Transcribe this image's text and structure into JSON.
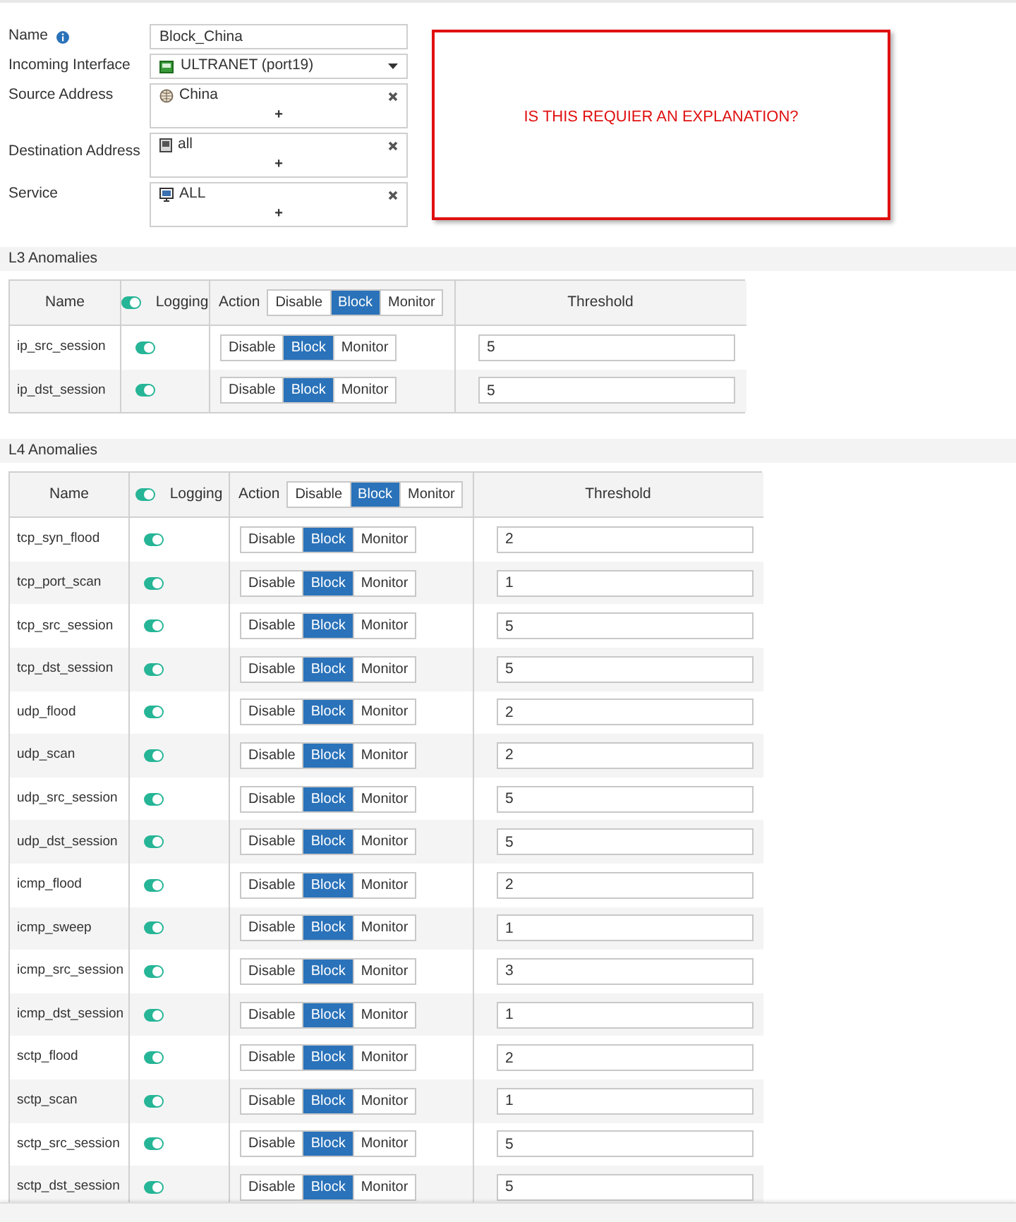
{
  "form": {
    "name": {
      "label": "Name",
      "value": "Block_China"
    },
    "incoming_interface": {
      "label": "Incoming Interface",
      "value": "ULTRANET (port19)"
    },
    "address_fields": [
      {
        "label": "Source Address",
        "kind": "globe",
        "item": "China",
        "add": "+"
      },
      {
        "label": "Destination Address",
        "kind": "monitor",
        "item": "all",
        "add": "+"
      },
      {
        "label": "Service",
        "kind": "service",
        "item": "ALL",
        "add": "+"
      }
    ]
  },
  "annotation": {
    "text": "IS THIS REQUIER AN EXPLANATION?"
  },
  "sections": [
    {
      "title": "L3 Anomalies",
      "columns": {
        "name": "Name",
        "logging": "Logging",
        "logging_on": true,
        "action": "Action",
        "actions": [
          {
            "label": "Disable",
            "selected": false
          },
          {
            "label": "Block",
            "selected": true
          },
          {
            "label": "Monitor",
            "selected": false
          }
        ],
        "threshold": "Threshold"
      },
      "rows": [
        {
          "name": "ip_src_session",
          "logging": true,
          "actions": [
            {
              "label": "Disable",
              "selected": false
            },
            {
              "label": "Block",
              "selected": true
            },
            {
              "label": "Monitor",
              "selected": false
            }
          ],
          "threshold": "5"
        },
        {
          "name": "ip_dst_session",
          "logging": true,
          "actions": [
            {
              "label": "Disable",
              "selected": false
            },
            {
              "label": "Block",
              "selected": true
            },
            {
              "label": "Monitor",
              "selected": false
            }
          ],
          "threshold": "5"
        }
      ]
    },
    {
      "title": "L4 Anomalies",
      "columns": {
        "name": "Name",
        "logging": "Logging",
        "logging_on": true,
        "action": "Action",
        "actions": [
          {
            "label": "Disable",
            "selected": false
          },
          {
            "label": "Block",
            "selected": true
          },
          {
            "label": "Monitor",
            "selected": false
          }
        ],
        "threshold": "Threshold"
      },
      "rows": [
        {
          "name": "tcp_syn_flood",
          "logging": true,
          "actions": [
            {
              "label": "Disable",
              "selected": false
            },
            {
              "label": "Block",
              "selected": true
            },
            {
              "label": "Monitor",
              "selected": false
            }
          ],
          "threshold": "2"
        },
        {
          "name": "tcp_port_scan",
          "logging": true,
          "actions": [
            {
              "label": "Disable",
              "selected": false
            },
            {
              "label": "Block",
              "selected": true
            },
            {
              "label": "Monitor",
              "selected": false
            }
          ],
          "threshold": "1"
        },
        {
          "name": "tcp_src_session",
          "logging": true,
          "actions": [
            {
              "label": "Disable",
              "selected": false
            },
            {
              "label": "Block",
              "selected": true
            },
            {
              "label": "Monitor",
              "selected": false
            }
          ],
          "threshold": "5"
        },
        {
          "name": "tcp_dst_session",
          "logging": true,
          "actions": [
            {
              "label": "Disable",
              "selected": false
            },
            {
              "label": "Block",
              "selected": true
            },
            {
              "label": "Monitor",
              "selected": false
            }
          ],
          "threshold": "5"
        },
        {
          "name": "udp_flood",
          "logging": true,
          "actions": [
            {
              "label": "Disable",
              "selected": false
            },
            {
              "label": "Block",
              "selected": true
            },
            {
              "label": "Monitor",
              "selected": false
            }
          ],
          "threshold": "2"
        },
        {
          "name": "udp_scan",
          "logging": true,
          "actions": [
            {
              "label": "Disable",
              "selected": false
            },
            {
              "label": "Block",
              "selected": true
            },
            {
              "label": "Monitor",
              "selected": false
            }
          ],
          "threshold": "2"
        },
        {
          "name": "udp_src_session",
          "logging": true,
          "actions": [
            {
              "label": "Disable",
              "selected": false
            },
            {
              "label": "Block",
              "selected": true
            },
            {
              "label": "Monitor",
              "selected": false
            }
          ],
          "threshold": "5"
        },
        {
          "name": "udp_dst_session",
          "logging": true,
          "actions": [
            {
              "label": "Disable",
              "selected": false
            },
            {
              "label": "Block",
              "selected": true
            },
            {
              "label": "Monitor",
              "selected": false
            }
          ],
          "threshold": "5"
        },
        {
          "name": "icmp_flood",
          "logging": true,
          "actions": [
            {
              "label": "Disable",
              "selected": false
            },
            {
              "label": "Block",
              "selected": true
            },
            {
              "label": "Monitor",
              "selected": false
            }
          ],
          "threshold": "2"
        },
        {
          "name": "icmp_sweep",
          "logging": true,
          "actions": [
            {
              "label": "Disable",
              "selected": false
            },
            {
              "label": "Block",
              "selected": true
            },
            {
              "label": "Monitor",
              "selected": false
            }
          ],
          "threshold": "1"
        },
        {
          "name": "icmp_src_session",
          "logging": true,
          "actions": [
            {
              "label": "Disable",
              "selected": false
            },
            {
              "label": "Block",
              "selected": true
            },
            {
              "label": "Monitor",
              "selected": false
            }
          ],
          "threshold": "3"
        },
        {
          "name": "icmp_dst_session",
          "logging": true,
          "actions": [
            {
              "label": "Disable",
              "selected": false
            },
            {
              "label": "Block",
              "selected": true
            },
            {
              "label": "Monitor",
              "selected": false
            }
          ],
          "threshold": "1"
        },
        {
          "name": "sctp_flood",
          "logging": true,
          "actions": [
            {
              "label": "Disable",
              "selected": false
            },
            {
              "label": "Block",
              "selected": true
            },
            {
              "label": "Monitor",
              "selected": false
            }
          ],
          "threshold": "2"
        },
        {
          "name": "sctp_scan",
          "logging": true,
          "actions": [
            {
              "label": "Disable",
              "selected": false
            },
            {
              "label": "Block",
              "selected": true
            },
            {
              "label": "Monitor",
              "selected": false
            }
          ],
          "threshold": "1"
        },
        {
          "name": "sctp_src_session",
          "logging": true,
          "actions": [
            {
              "label": "Disable",
              "selected": false
            },
            {
              "label": "Block",
              "selected": true
            },
            {
              "label": "Monitor",
              "selected": false
            }
          ],
          "threshold": "5"
        },
        {
          "name": "sctp_dst_session",
          "logging": true,
          "actions": [
            {
              "label": "Disable",
              "selected": false
            },
            {
              "label": "Block",
              "selected": true
            },
            {
              "label": "Monitor",
              "selected": false
            }
          ],
          "threshold": "5"
        }
      ]
    }
  ]
}
